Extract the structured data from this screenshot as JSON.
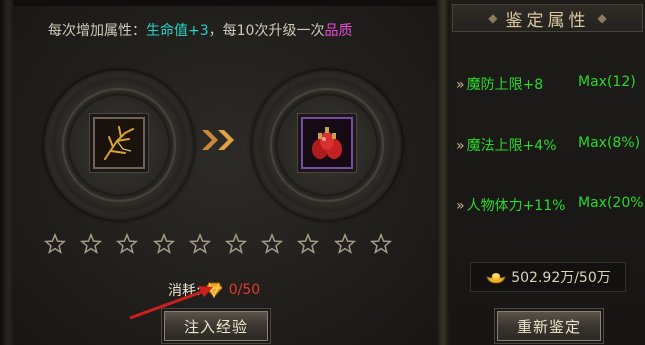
{
  "header": {
    "info_prefix": "每次增加属性：",
    "info_stat": "生命值+3",
    "info_middle": "，每10次升级一次",
    "info_quality": "品质"
  },
  "colors": {
    "stat": "#27d3c8",
    "quality": "#e84bd8",
    "attr_green": "#29d82b",
    "cost_red": "#e03a2e"
  },
  "stars": {
    "filled": 0,
    "total": 10
  },
  "cost": {
    "label": "消耗:",
    "value": "0/50",
    "icon": "gem-icon"
  },
  "buttons": {
    "inject": "注入经验",
    "reroll": "重新鉴定"
  },
  "side": {
    "title": "鉴定属性",
    "attributes": [
      {
        "text": "魔防上限+8",
        "max": "Max(12)"
      },
      {
        "text": "魔法上限+4%",
        "max": "Max(8%)"
      },
      {
        "text": "人物体力+11%",
        "max": "Max(20%"
      }
    ],
    "gold": "502.92万/50万",
    "gold_icon": "gold-ingot-icon"
  },
  "items": {
    "left_icon": "golden-branch-icon",
    "right_icon": "red-potions-icon"
  }
}
